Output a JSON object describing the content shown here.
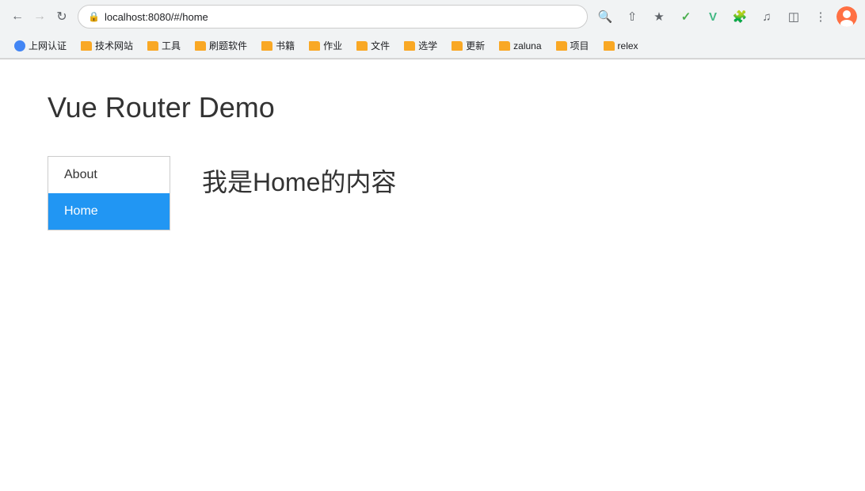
{
  "browser": {
    "url": "localhost:8080/#/home",
    "back_disabled": false,
    "forward_disabled": true
  },
  "bookmarks": [
    {
      "id": "bm-shang",
      "icon": "globe",
      "label": "上网认证"
    },
    {
      "id": "bm-tech",
      "icon": "folder",
      "label": "技术网站"
    },
    {
      "id": "bm-tools",
      "icon": "folder",
      "label": "工具"
    },
    {
      "id": "bm-brush",
      "icon": "folder",
      "label": "刷题软件"
    },
    {
      "id": "bm-books",
      "icon": "folder",
      "label": "书籍"
    },
    {
      "id": "bm-work",
      "icon": "folder",
      "label": "作业"
    },
    {
      "id": "bm-file",
      "icon": "folder",
      "label": "文件"
    },
    {
      "id": "bm-select",
      "icon": "folder",
      "label": "选学"
    },
    {
      "id": "bm-update",
      "icon": "folder",
      "label": "更新"
    },
    {
      "id": "bm-zaluna",
      "icon": "folder",
      "label": "zaluna"
    },
    {
      "id": "bm-project",
      "icon": "folder",
      "label": "项目"
    },
    {
      "id": "bm-relex",
      "icon": "folder",
      "label": "relex"
    }
  ],
  "page": {
    "title": "Vue Router Demo",
    "nav_items": [
      {
        "id": "nav-about",
        "label": "About",
        "active": false
      },
      {
        "id": "nav-home",
        "label": "Home",
        "active": true
      }
    ],
    "content": "我是Home的内容",
    "active_route": "home"
  },
  "toolbar": {
    "search_icon_title": "search",
    "share_icon_title": "share",
    "bookmark_icon_title": "bookmark",
    "extensions_icon_title": "extensions",
    "music_icon_title": "music",
    "split_icon_title": "split",
    "menu_icon_title": "menu"
  }
}
